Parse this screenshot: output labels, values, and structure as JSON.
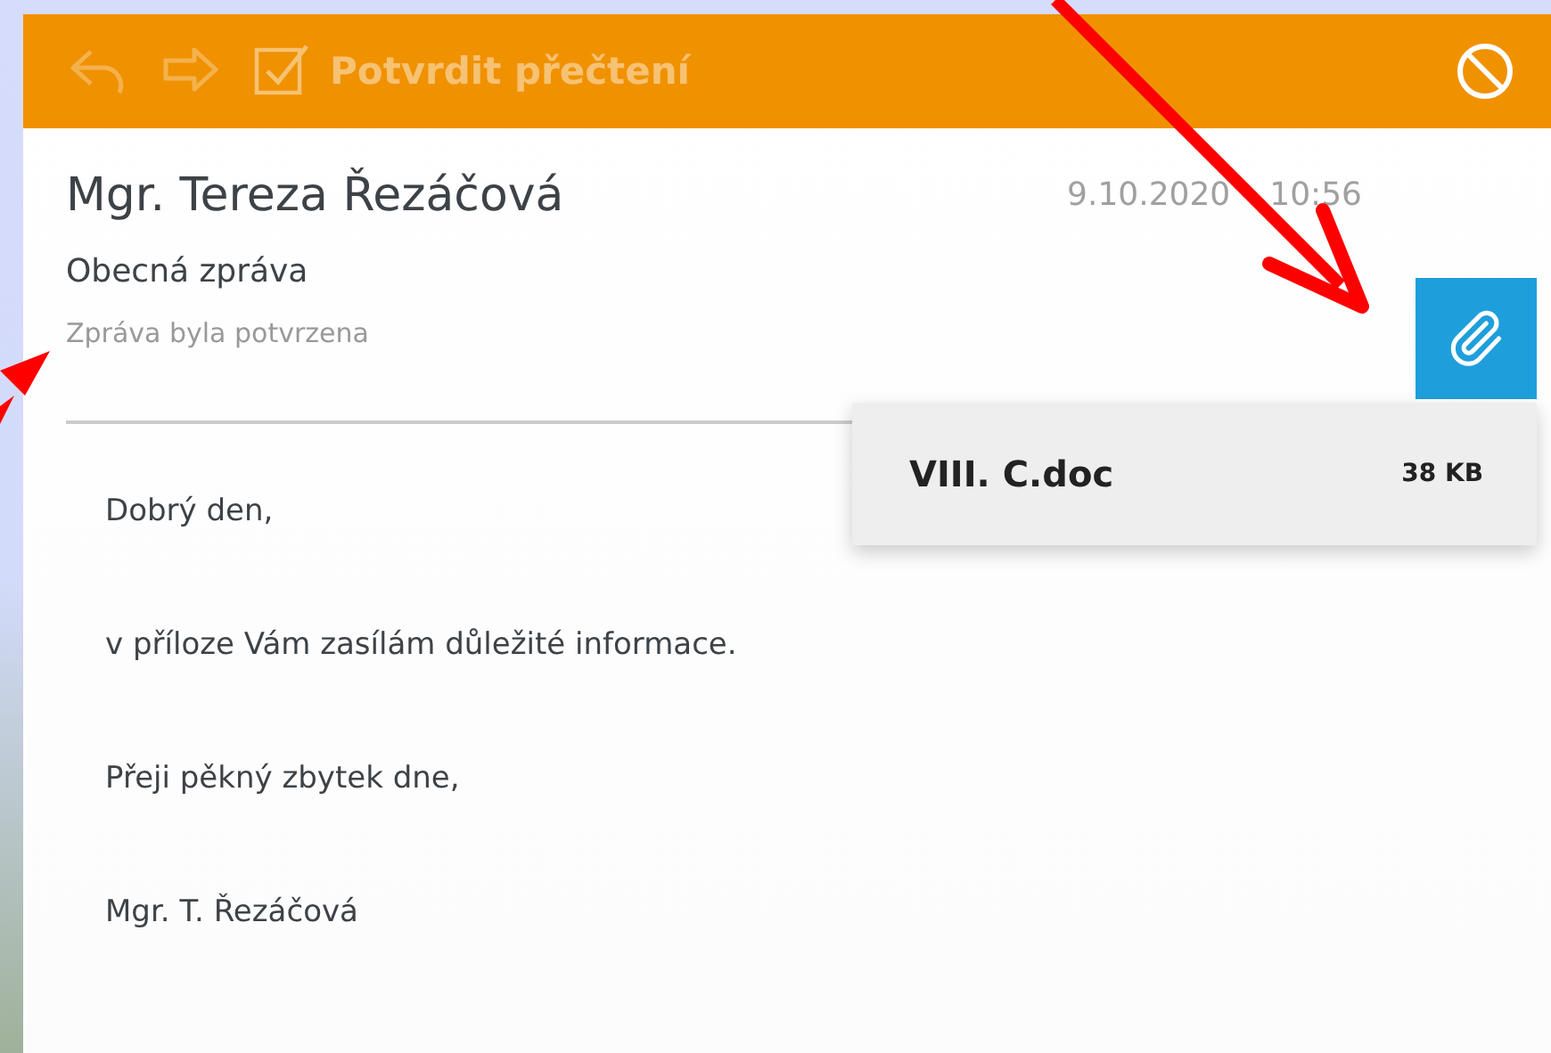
{
  "toolbar": {
    "actions": [
      {
        "kind": "reply",
        "disabled": true
      },
      {
        "kind": "forward",
        "disabled": true
      },
      {
        "kind": "confirm",
        "label": "Potvrdit přečtení",
        "disabled": true
      },
      {
        "kind": "block",
        "disabled": false
      }
    ]
  },
  "message": {
    "sender": "Mgr. Tereza Řezáčová",
    "date": "9.10.2020",
    "time": "10:56",
    "subject": "Obecná zpráva",
    "status": "Zpráva byla potvrzena",
    "body": [
      "Dobrý den,",
      "v příloze Vám zasílám důležité informace.",
      "Přeji pěkný zbytek dne,",
      "Mgr. T. Řezáčová"
    ]
  },
  "attachments": {
    "expanded": true,
    "files": [
      {
        "name": "VIII. C.doc",
        "size": "38 KB"
      }
    ]
  }
}
